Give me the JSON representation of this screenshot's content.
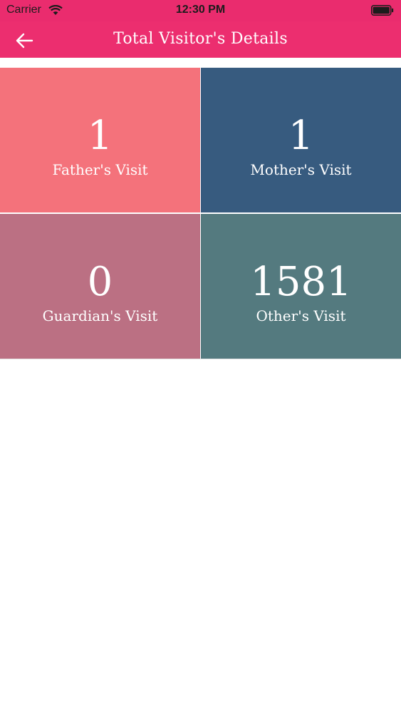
{
  "status_bar": {
    "carrier": "Carrier",
    "time": "12:30 PM"
  },
  "header": {
    "title": "Total Visitor's Details",
    "background_color": "#ec2e6f",
    "back_icon": "arrow-left-icon"
  },
  "tiles": [
    {
      "count": "1",
      "label": "Father's Visit",
      "color": "#f4727b"
    },
    {
      "count": "1",
      "label": "Mother's Visit",
      "color": "#375b7f"
    },
    {
      "count": "0",
      "label": "Guardian's Visit",
      "color": "#bb7083"
    },
    {
      "count": "1581",
      "label": "Other's Visit",
      "color": "#547a7f"
    }
  ]
}
